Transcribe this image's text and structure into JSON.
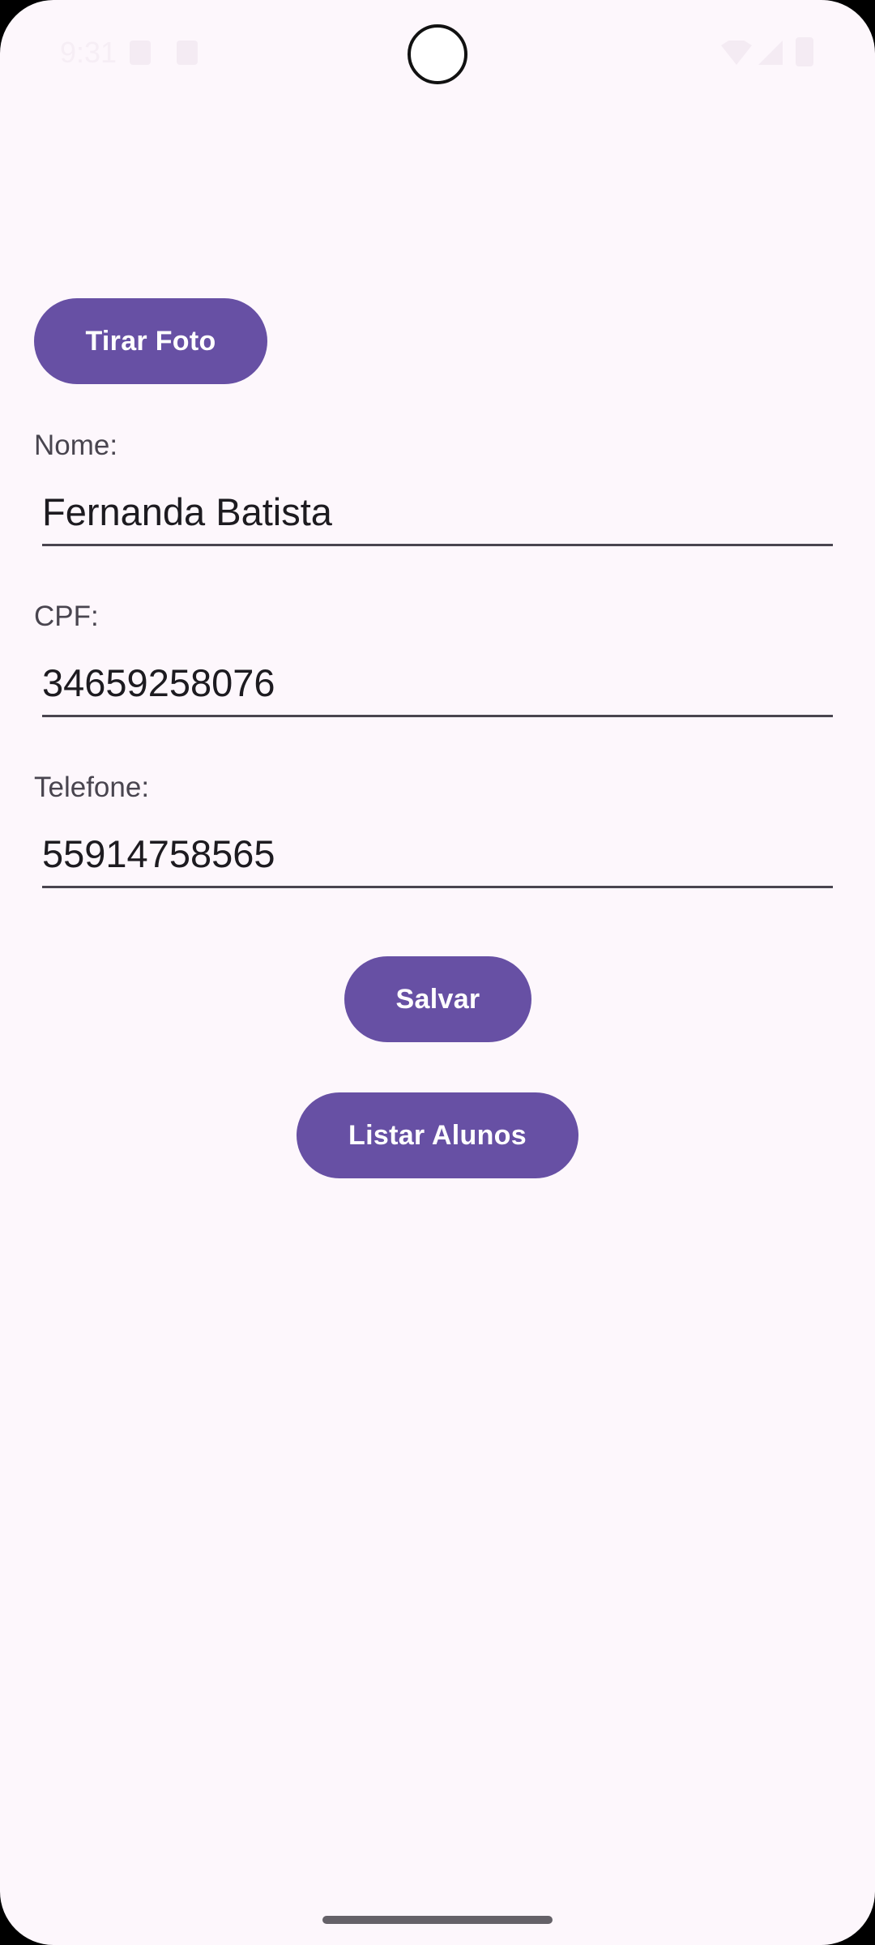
{
  "status_bar": {
    "time": "9:31",
    "icons": [
      "sim-icon",
      "alarm-icon",
      "wifi-icon",
      "signal-icon",
      "battery-icon"
    ]
  },
  "form": {
    "photo_button_label": "Tirar Foto",
    "name_label": "Nome:",
    "name_value": "Fernanda Batista",
    "cpf_label": "CPF:",
    "cpf_value": "34659258076",
    "phone_label": "Telefone:",
    "phone_value": "55914758565",
    "save_button_label": "Salvar",
    "list_button_label": "Listar Alunos"
  },
  "colors": {
    "background": "#FDF7FC",
    "primary": "#6750A4",
    "on_primary": "#FFFFFF",
    "text": "#1D1B20",
    "label": "#49454F"
  }
}
